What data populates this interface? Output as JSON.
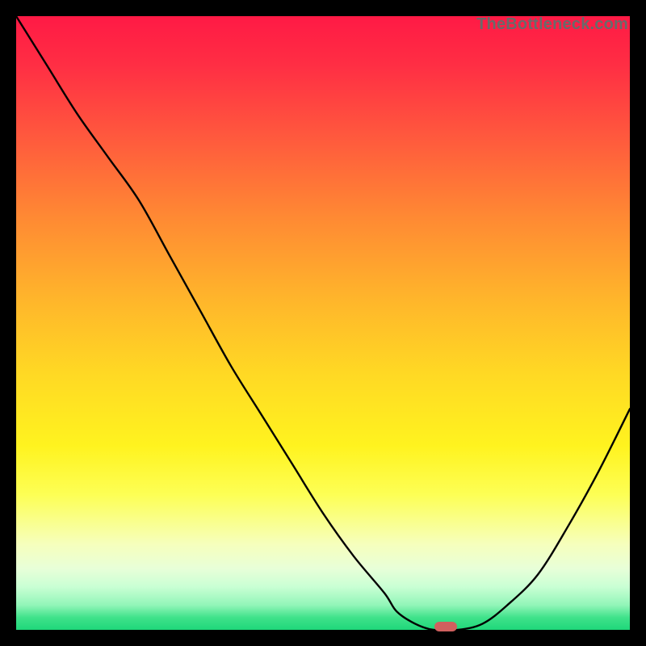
{
  "watermark": "TheBottleneck.com",
  "chart_data": {
    "type": "line",
    "title": "",
    "xlabel": "",
    "ylabel": "",
    "xlim": [
      0,
      100
    ],
    "ylim": [
      0,
      100
    ],
    "x": [
      0,
      5,
      10,
      15,
      20,
      25,
      30,
      35,
      40,
      45,
      50,
      55,
      60,
      62,
      65,
      68,
      72,
      76,
      80,
      85,
      90,
      95,
      100
    ],
    "values": [
      100,
      92,
      84,
      77,
      70,
      61,
      52,
      43,
      35,
      27,
      19,
      12,
      6,
      3,
      1,
      0,
      0,
      1,
      4,
      9,
      17,
      26,
      36
    ],
    "marker": {
      "x": 70,
      "y": 0
    },
    "gradient_stops": [
      {
        "pos": 0,
        "color": "#ff1a45"
      },
      {
        "pos": 20,
        "color": "#ff5a3d"
      },
      {
        "pos": 46,
        "color": "#ffb52b"
      },
      {
        "pos": 70,
        "color": "#fff31f"
      },
      {
        "pos": 90,
        "color": "#e8ffd8"
      },
      {
        "pos": 100,
        "color": "#1fd77a"
      }
    ]
  }
}
